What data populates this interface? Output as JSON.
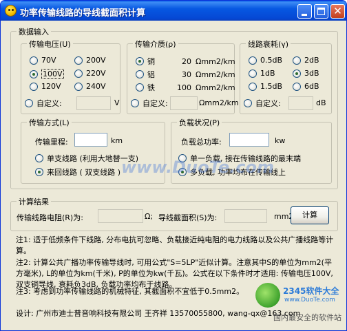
{
  "window": {
    "title": "功率传输线路的导线截面积计算"
  },
  "input_section": {
    "legend": "数据输入",
    "voltage": {
      "legend": "传输电压(U)",
      "options": [
        "70V",
        "200V",
        "100V",
        "220V",
        "120V",
        "240V"
      ],
      "selected": "100V",
      "custom_label": "自定义:",
      "custom_unit": "V"
    },
    "medium": {
      "legend": "传输介质(ρ)",
      "options": [
        {
          "name": "铜",
          "value": "20",
          "unit": "Ωmm2/km"
        },
        {
          "name": "铝",
          "value": "30",
          "unit": "Ωmm2/km"
        },
        {
          "name": "铁",
          "value": "100",
          "unit": "Ωmm2/km"
        }
      ],
      "selected": "铜",
      "custom_label": "自定义:",
      "custom_unit": "Ωmm2/km"
    },
    "attenuation": {
      "legend": "线路衰耗(γ)",
      "options": [
        "0.5dB",
        "2dB",
        "1dB",
        "3dB",
        "1.5dB",
        "6dB"
      ],
      "selected": "3dB",
      "custom_label": "自定义:",
      "custom_unit": "dB"
    },
    "method": {
      "legend": "传输方式(L)",
      "distance_label": "传输里程:",
      "distance_unit": "km",
      "options": [
        "单支线路 (利用大地替一支)",
        "来回线路 ( 双支线路 )"
      ],
      "selected": "来回线路 ( 双支线路 )"
    },
    "load": {
      "legend": "负载状况(P)",
      "power_label": "负载总功率:",
      "power_unit": "kw",
      "options": [
        "单一负载, 接在传输线路的最末端",
        "多负载, 功率均布在传输线上"
      ],
      "selected": "多负载, 功率均布在传输线上"
    }
  },
  "result_section": {
    "legend": "计算结果",
    "resistance_label": "传输线路电阻(R)为:",
    "resistance_unit": "Ω;",
    "area_label": "导线截面积(S)为:",
    "area_unit": "mm2",
    "calc_button": "计算"
  },
  "notes": {
    "n1": "注1: 适于低频条件下线路, 分布电抗可忽略、负载接近纯电阻的电力线路以及公共广播线路等计算。",
    "n2": "注2: 计算公共广播功率传输导线时, 可用公式\"S=5LP\"近似计算。注意其中S的单位为mm2(平方毫米), L的单位为km(千米), P的单位为kw(千瓦)。公式在以下条件时才适用: 传输电压100V, 双支铜导线, 衰耗负3dB, 负载功率均布于线路。",
    "n3": "注3: 考虑到功率传输线路的机械特征, 其截面积不宜低于0.5mm2。"
  },
  "footer": {
    "credit": "设计: 广州市迪士普音响科技有限公司 王齐祥 13570055800, wang-qx@163.com"
  },
  "watermarks": {
    "center": "www.DuoTe.com",
    "brand": "2345软件大全",
    "url": "www.DuoTe.com",
    "tagline": "国内最安全的软件站"
  }
}
